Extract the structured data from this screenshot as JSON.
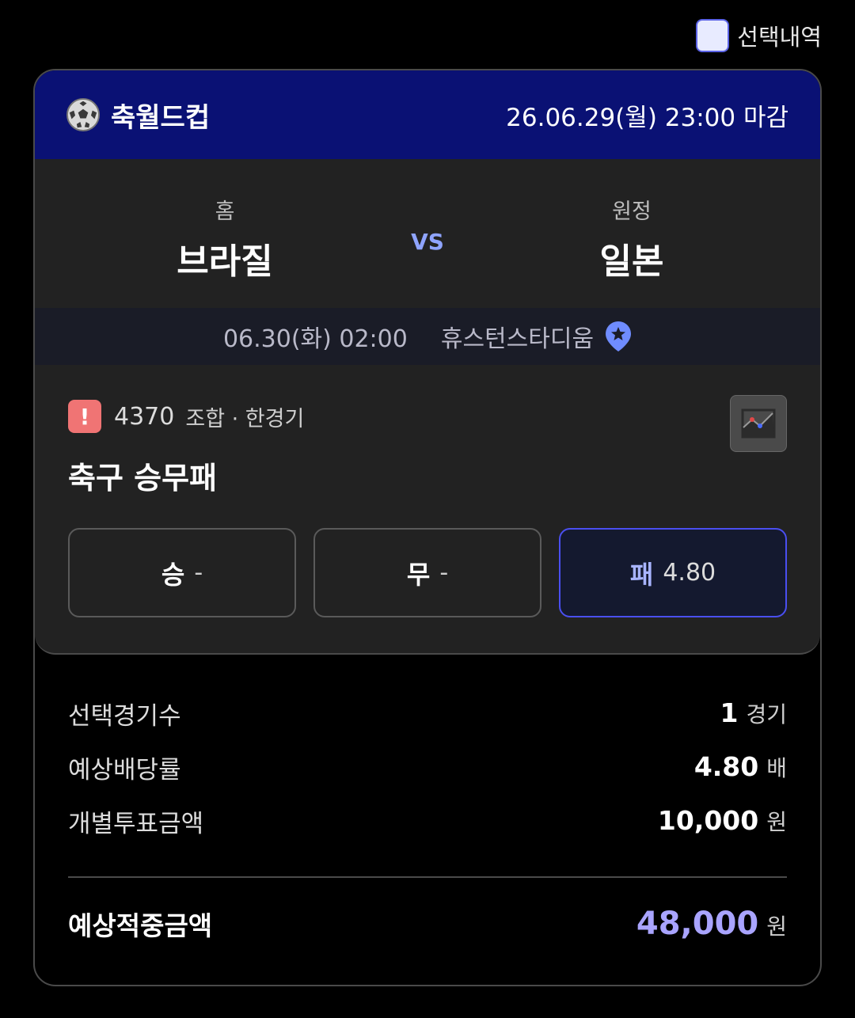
{
  "topbar": {
    "checkbox_label": "선택내역"
  },
  "header": {
    "league": "축월드컵",
    "league_icon": "soccer-ball-icon",
    "deadline": "26.06.29(월) 23:00 마감"
  },
  "match": {
    "home_role": "홈",
    "home_team": "브라질",
    "vs": "VS",
    "away_role": "원정",
    "away_team": "일본",
    "datetime": "06.30(화) 02:00",
    "venue": "휴스턴스타디움",
    "venue_icon": "map-pin-icon"
  },
  "bet": {
    "number": "4370",
    "type": "조합 · 한경기",
    "title": "축구 승무패",
    "options": [
      {
        "label": "승",
        "odds": "-",
        "selected": false
      },
      {
        "label": "무",
        "odds": "-",
        "selected": false
      },
      {
        "label": "패",
        "odds": "4.80",
        "selected": true
      }
    ]
  },
  "summary": {
    "rows": [
      {
        "label": "선택경기수",
        "value": "1",
        "unit": "경기"
      },
      {
        "label": "예상배당률",
        "value": "4.80",
        "unit": "배"
      },
      {
        "label": "개별투표금액",
        "value": "10,000",
        "unit": "원"
      }
    ],
    "total": {
      "label": "예상적중금액",
      "value": "48,000",
      "unit": "원"
    }
  },
  "colors": {
    "header_bg": "#0a1174",
    "selected_border": "#4a4ff0",
    "total_accent": "#a9a4ff",
    "alert": "#f07474"
  }
}
